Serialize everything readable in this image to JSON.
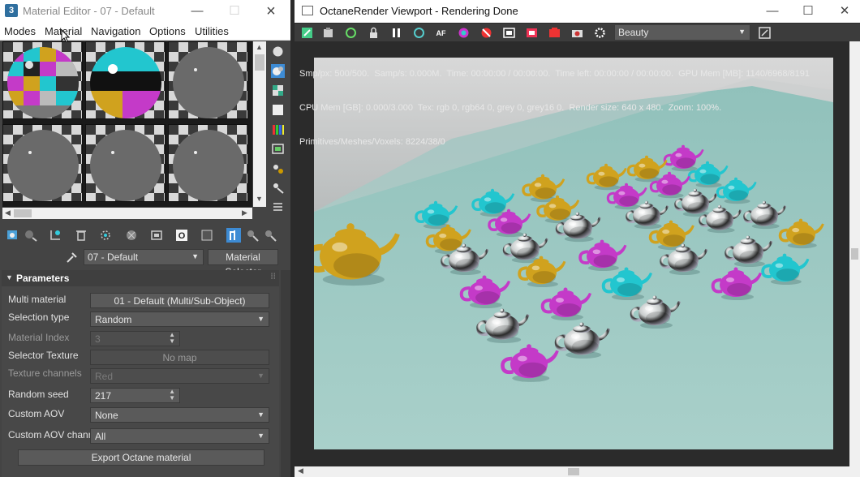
{
  "material_editor": {
    "title": "Material Editor - 07 - Default",
    "app_icon": "3",
    "menu": [
      "Modes",
      "Material",
      "Navigation",
      "Options",
      "Utilities"
    ],
    "current_material": "07 - Default",
    "material_selector_label": "Material Selector",
    "params_header": "Parameters",
    "labels": {
      "multi_material": "Multi material",
      "selection_type": "Selection type",
      "material_index": "Material Index",
      "selector_texture": "Selector Texture",
      "texture_channels": "Texture channels",
      "random_seed": "Random seed",
      "custom_aov": "Custom AOV",
      "custom_aov_channel": "Custom AOV channel"
    },
    "values": {
      "multi_material": "01 - Default (Multi/Sub-Object)",
      "selection_type": "Random",
      "material_index": "3",
      "selector_texture": "No map",
      "texture_channels": "Red",
      "random_seed": "217",
      "custom_aov": "None",
      "custom_aov_channel": "All"
    },
    "export_button": "Export Octane material",
    "icons": {
      "close": "×",
      "minimize": "—",
      "maximize": "☐",
      "dropdown": "▼",
      "collapse": "▼",
      "spin": "▲▼",
      "scroll_up": "▲",
      "scroll_down": "▼",
      "scroll_left": "◀",
      "scroll_right": "▶"
    }
  },
  "viewport": {
    "title": "OctaneRender Viewport - Rendering Done",
    "render_pass": "Beauty",
    "stats": [
      "Smp/px: 500/500.  Samp/s: 0.000M.  Time: 00:00:00 / 00:00:00.  Time left: 00:00:00 / 00:00:00.  GPU Mem [MB]: 1140/6968/8191",
      "CPU Mem [GB]: 0.000/3.000  Tex: rgb 0, rgb64 0, grey 0, grey16 0.  Render size: 640 x 480.  Zoom: 100%.",
      "Primitives/Meshes/Voxels: 8224/38/0"
    ],
    "icons": {
      "close": "✕",
      "minimize": "—",
      "maximize": "☐",
      "dropdown": "▼"
    }
  },
  "colors": {
    "cyan": "#22c6cf",
    "magenta": "#c43ac8",
    "gold": "#d0a21e",
    "floor": "#9ac6c0",
    "chrome": "#d4d8d8"
  }
}
